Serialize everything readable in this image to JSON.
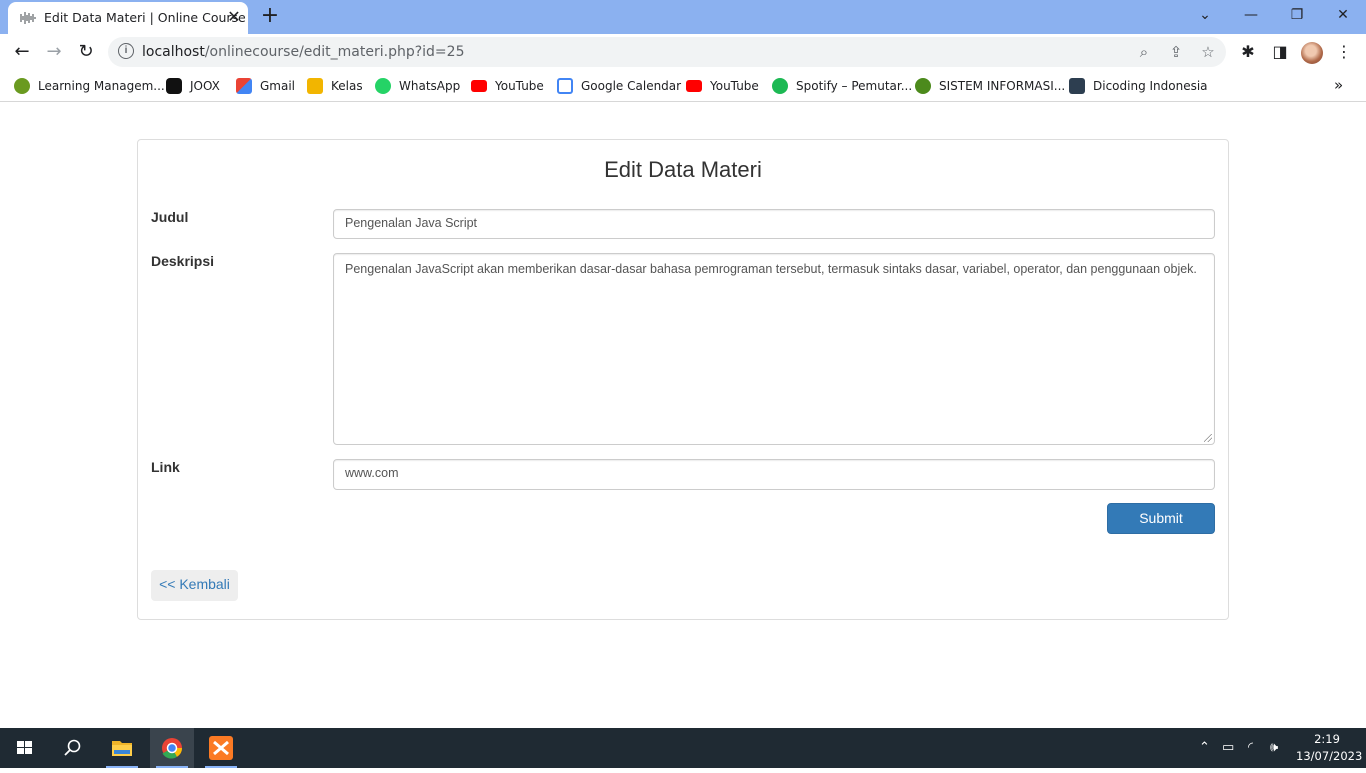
{
  "browser": {
    "tab_title": "Edit Data Materi | Online Course",
    "url_host": "localhost",
    "url_path": "/onlinecourse/edit_materi.php?id=25",
    "bookmarks": [
      {
        "label": "Learning Managem...",
        "icon": "moodle-icon",
        "color": "#6a9a20"
      },
      {
        "label": "JOOX",
        "icon": "joox-icon",
        "color": "#111111"
      },
      {
        "label": "Gmail",
        "icon": "gmail-icon",
        "color": "#ea4335"
      },
      {
        "label": "Kelas",
        "icon": "classroom-icon",
        "color": "#f2b500"
      },
      {
        "label": "WhatsApp",
        "icon": "whatsapp-icon",
        "color": "#25d366"
      },
      {
        "label": "YouTube",
        "icon": "youtube-icon",
        "color": "#ff0000"
      },
      {
        "label": "Google Calendar",
        "icon": "calendar-icon",
        "color": "#4285f4"
      },
      {
        "label": "YouTube",
        "icon": "youtube-icon",
        "color": "#ff0000"
      },
      {
        "label": "Spotify – Pemutar...",
        "icon": "spotify-icon",
        "color": "#1db954"
      },
      {
        "label": "SISTEM INFORMASI...",
        "icon": "university-icon",
        "color": "#4c8a1c"
      },
      {
        "label": "Dicoding Indonesia",
        "icon": "dicoding-icon",
        "color": "#2d3e50"
      }
    ]
  },
  "form": {
    "title": "Edit Data Materi",
    "judul_label": "Judul",
    "judul_value": "Pengenalan Java Script",
    "deskripsi_label": "Deskripsi",
    "deskripsi_value": "Pengenalan JavaScript akan memberikan dasar-dasar bahasa pemrograman tersebut, termasuk sintaks dasar, variabel, operator, dan penggunaan objek.",
    "link_label": "Link",
    "link_value": "www.com",
    "submit_label": "Submit",
    "back_label": "<< Kembali"
  },
  "taskbar": {
    "time": "2:19",
    "date": "13/07/2023"
  },
  "colors": {
    "primary": "#337ab7",
    "chrome_frame": "#8bb1f0",
    "taskbar": "#1f2a33"
  }
}
